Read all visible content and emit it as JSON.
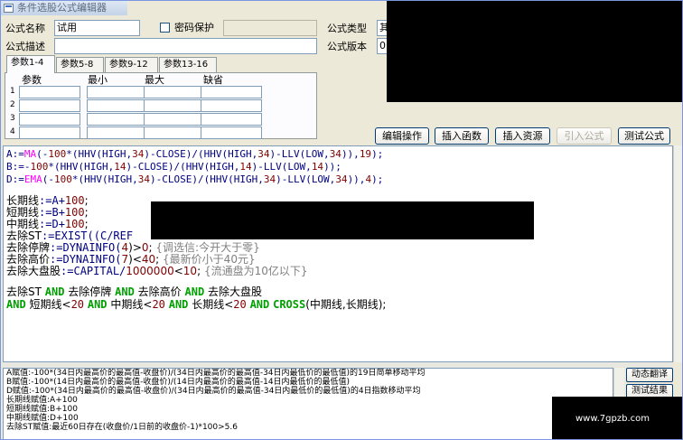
{
  "window": {
    "title": "条件选股公式编辑器"
  },
  "form": {
    "name_label": "公式名称",
    "name_value": "试用",
    "password_label": "密码保护",
    "password_checked": false,
    "password_value": "",
    "type_label": "公式类型",
    "type_value": "其",
    "desc_label": "公式描述",
    "desc_value": "",
    "version_label": "公式版本",
    "version_value": "0"
  },
  "tabs": [
    {
      "label": "参数1-4",
      "active": true
    },
    {
      "label": "参数5-8",
      "active": false
    },
    {
      "label": "参数9-12",
      "active": false
    },
    {
      "label": "参数13-16",
      "active": false
    }
  ],
  "params": {
    "headers": [
      "参数",
      "最小",
      "最大",
      "缺省"
    ],
    "rows": [
      "1",
      "2",
      "3",
      "4"
    ]
  },
  "buttons": {
    "edit_ops": "编辑操作",
    "insert_func": "插入函数",
    "insert_resource": "插入资源",
    "import_formula": "引入公式",
    "test_formula": "测试公式"
  },
  "editor": {
    "line_a": {
      "name": "A:=",
      "fn": "MA",
      "o": "(-",
      "n1": "100",
      "m": "*(HHV(HIGH,",
      "n2": "34",
      "p": ")-CLOSE)/(HHV(HIGH,",
      "n3": "34",
      "q": ")-LLV(LOW,",
      "n4": "34",
      "r": ")),",
      "n5": "19",
      "s": ");"
    },
    "line_b": {
      "name": "B:=",
      "o": "-",
      "n1": "100",
      "m": "*(HHV(HIGH,",
      "n2": "14",
      "p": ")-CLOSE)/(HHV(HIGH,",
      "n3": "14",
      "q": ")-LLV(LOW,",
      "n4": "14",
      "r": "));"
    },
    "line_d": {
      "name": "D:=",
      "fn": "EMA",
      "o": "(-",
      "n1": "100",
      "m": "*(HHV(HIGH,",
      "n2": "34",
      "p": ")-CLOSE)/(HHV(HIGH,",
      "n3": "34",
      "q": ")-LLV(LOW,",
      "n4": "34",
      "r": ")),",
      "n5": "4",
      "s": ");"
    },
    "long_line": {
      "name": "长期线",
      "expr": ":=A+",
      "num": "100",
      "end": ";"
    },
    "short_line": {
      "name": "短期线",
      "expr": ":=B+",
      "num": "100",
      "end": ";"
    },
    "mid_line": {
      "name": "中期线",
      "expr": ":=D+",
      "num": "100",
      "end": ";"
    },
    "remove_st": {
      "name": "去除ST",
      "expr": ":=EXIST((C/REF"
    },
    "remove_halt": {
      "name": "去除停牌",
      "expr": ":=DYNAINFO(",
      "n1": "4",
      "mid": ")>",
      "n2": "0",
      "end": ";",
      "comment": "{调选信:今开大于零}"
    },
    "remove_high": {
      "name": "去除高价",
      "expr": ":=DYNAINFO(",
      "n1": "7",
      "mid": ")<",
      "n2": "40",
      "end": ";",
      "comment": "{最新价小于40元}"
    },
    "remove_big": {
      "name": "去除大盘股",
      "expr": ":=CAPITAL/",
      "n1": "1000000",
      "mid": "<",
      "n2": "10",
      "end": ";",
      "comment": "{流通盘为10亿以下}"
    },
    "cond1": {
      "a": "去除ST",
      "k1": "AND",
      "b": "去除停牌",
      "k2": "AND",
      "c": "去除高价",
      "k3": "AND",
      "d": "去除大盘股"
    },
    "cond2": {
      "k0": "AND",
      "a": "短期线<",
      "n1": "20",
      "k1": "AND",
      "b": "中期线<",
      "n2": "20",
      "k2": "AND",
      "c": "长期线<",
      "n3": "20",
      "k3": "AND",
      "fn": "CROSS",
      "d": "(中期线,长期线);"
    }
  },
  "output": {
    "lines": [
      "A赋值:-100*(34日内最高价的最高值-收盘价)/(34日内最高价的最高值-34日内最低价的最低值)的19日简单移动平均",
      "B赋值:-100*(14日内最高价的最高值-收盘价)/(14日内最高价的最高值-14日内最低价的最低值)",
      "D赋值:-100*(34日内最高价的最高值-收盘价)/(34日内最高价的最高值-34日内最低价的最低值)的4日指数移动平均",
      "长期线赋值:A+100",
      "短期线赋值:B+100",
      "中期线赋值:D+100",
      "去除ST赋值:最近60日存在(收盘价/1日前的收盘价-1)*100>5.6"
    ],
    "translate_btn": "动态翻译",
    "test_result_btn": "测试结果"
  },
  "watermark": "www.7gpzb.com"
}
